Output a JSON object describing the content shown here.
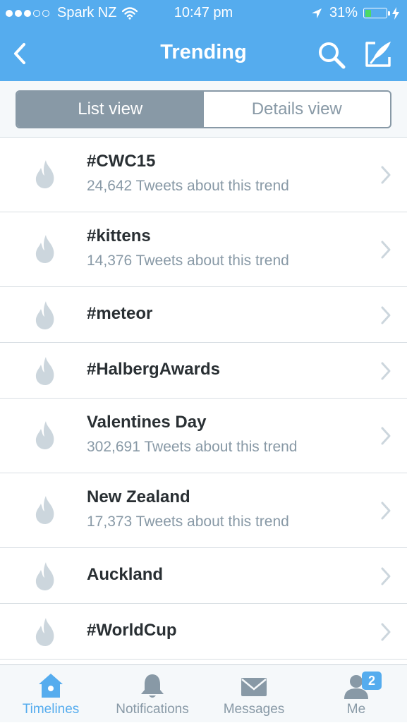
{
  "status_bar": {
    "carrier": "Spark NZ",
    "time": "10:47 pm",
    "battery": "31%",
    "signal_bars_filled": 3,
    "signal_bars_total": 5,
    "battery_level": 0.31
  },
  "nav": {
    "title": "Trending",
    "back_icon": "chevron-left-icon",
    "search_icon": "search-icon",
    "compose_icon": "compose-icon"
  },
  "segment": {
    "list_view": "List view",
    "details_view": "Details view",
    "selected": "List view"
  },
  "trends": [
    {
      "name": "#CWC15",
      "count": "24,642 Tweets about this trend"
    },
    {
      "name": "#kittens",
      "count": "14,376 Tweets about this trend"
    },
    {
      "name": "#meteor",
      "count": ""
    },
    {
      "name": "#HalbergAwards",
      "count": ""
    },
    {
      "name": "Valentines Day",
      "count": "302,691 Tweets about this trend"
    },
    {
      "name": "New Zealand",
      "count": "17,373 Tweets about this trend"
    },
    {
      "name": "Auckland",
      "count": ""
    },
    {
      "name": "#WorldCup",
      "count": ""
    }
  ],
  "tabs": {
    "timelines": "Timelines",
    "notifications": "Notifications",
    "messages": "Messages",
    "me": "Me",
    "active": "Timelines",
    "me_badge": "2"
  },
  "colors": {
    "brand": "#55acee",
    "secondary_text": "#8899a6",
    "primary_text": "#292f33",
    "battery": "#4cd964",
    "icon_gray": "#ccd6dd"
  }
}
